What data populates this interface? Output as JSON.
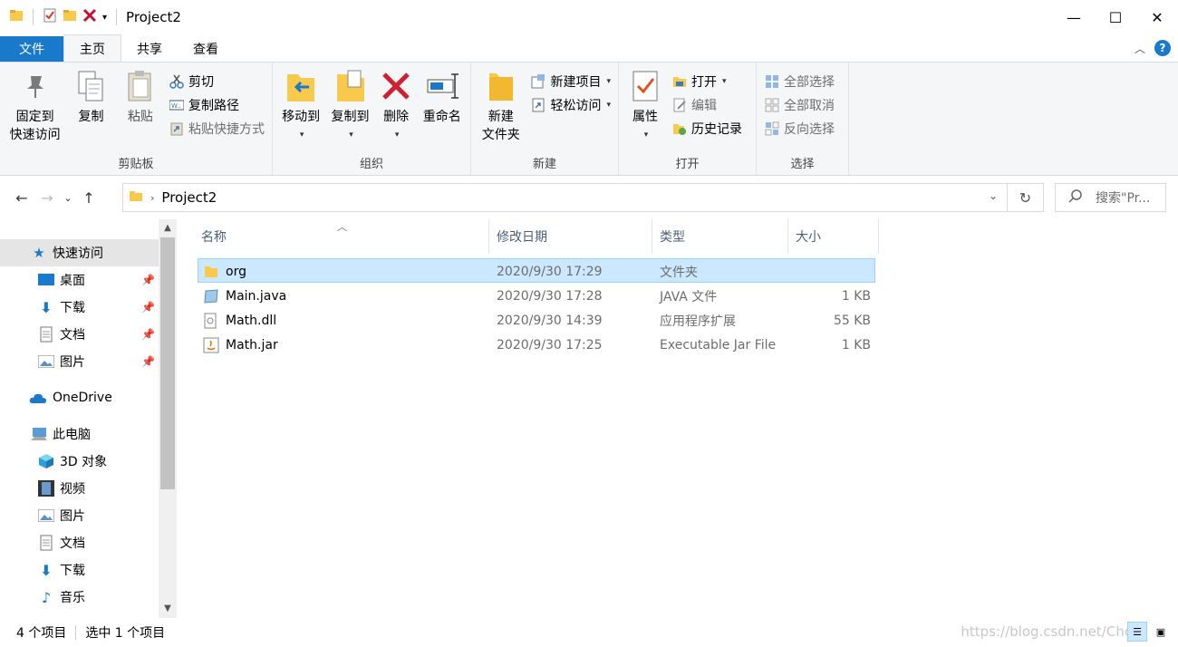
{
  "window": {
    "title": "Project2",
    "minimize": "—",
    "maximize": "☐",
    "close": "✕"
  },
  "tabs": [
    {
      "label": "文件"
    },
    {
      "label": "主页"
    },
    {
      "label": "共享"
    },
    {
      "label": "查看"
    }
  ],
  "ribbon": {
    "clipboard": {
      "pin_line1": "固定到",
      "pin_line2": "快速访问",
      "copy": "复制",
      "paste": "粘贴",
      "cut": "剪切",
      "copy_path": "复制路径",
      "paste_shortcut": "粘贴快捷方式",
      "label": "剪贴板"
    },
    "organize": {
      "move_to": "移动到",
      "copy_to": "复制到",
      "delete": "删除",
      "rename": "重命名",
      "label": "组织"
    },
    "new": {
      "new_folder_line1": "新建",
      "new_folder_line2": "文件夹",
      "new_item": "新建项目",
      "easy_access": "轻松访问",
      "label": "新建"
    },
    "open": {
      "properties": "属性",
      "open": "打开",
      "edit": "编辑",
      "history": "历史记录",
      "label": "打开"
    },
    "select": {
      "select_all": "全部选择",
      "select_none": "全部取消",
      "invert": "反向选择",
      "label": "选择"
    }
  },
  "address": {
    "crumb": "Project2",
    "search_placeholder": "搜索\"Pr..."
  },
  "nav": {
    "items": [
      {
        "label": "快速访问"
      },
      {
        "label": "桌面"
      },
      {
        "label": "下载"
      },
      {
        "label": "文档"
      },
      {
        "label": "图片"
      },
      {
        "label": "OneDrive"
      },
      {
        "label": "此电脑"
      },
      {
        "label": "3D 对象"
      },
      {
        "label": "视频"
      },
      {
        "label": "图片"
      },
      {
        "label": "文档"
      },
      {
        "label": "下载"
      },
      {
        "label": "音乐"
      }
    ]
  },
  "columns": {
    "name": "名称",
    "modified": "修改日期",
    "type": "类型",
    "size": "大小"
  },
  "files": [
    {
      "name": "org",
      "modified": "2020/9/30 17:29",
      "type": "文件夹",
      "size": ""
    },
    {
      "name": "Main.java",
      "modified": "2020/9/30 17:28",
      "type": "JAVA 文件",
      "size": "1 KB"
    },
    {
      "name": "Math.dll",
      "modified": "2020/9/30 14:39",
      "type": "应用程序扩展",
      "size": "55 KB"
    },
    {
      "name": "Math.jar",
      "modified": "2020/9/30 17:25",
      "type": "Executable Jar File",
      "size": "1 KB"
    }
  ],
  "status": {
    "count": "4 个项目",
    "selected": "选中 1 个项目"
  },
  "watermark": "https://blog.csdn.net/Cho",
  "colors": {
    "accent": "#1979ca",
    "selection": "#cce8ff",
    "folder": "#f8c94b"
  }
}
